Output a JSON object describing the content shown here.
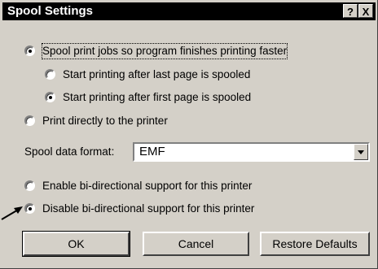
{
  "dialog": {
    "title": "Spool Settings",
    "help_label": "?",
    "close_label": "X"
  },
  "options": {
    "spool": "Spool print jobs so program finishes printing faster",
    "start_last": "Start printing after last page is spooled",
    "start_first": "Start printing after first page is spooled",
    "direct": "Print directly to the printer",
    "enable_bidi": "Enable bi-directional support for this printer",
    "disable_bidi": "Disable bi-directional support for this printer"
  },
  "format": {
    "label": "Spool data format:",
    "value": "EMF"
  },
  "buttons": {
    "ok": "OK",
    "cancel": "Cancel",
    "restore": "Restore Defaults"
  }
}
